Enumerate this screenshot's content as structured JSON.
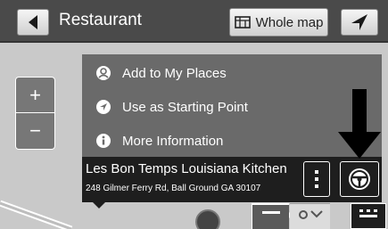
{
  "header": {
    "title": "Restaurant",
    "back_icon": "chevron-left-icon",
    "whole_map_label": "Whole map",
    "whole_map_icon": "map-icon",
    "navigation_icon": "navigation-arrow-icon"
  },
  "zoom": {
    "in_label": "+",
    "out_label": "−"
  },
  "menu": {
    "items": [
      {
        "label": "Add to My Places",
        "icon": "add-place-icon"
      },
      {
        "label": "Use as Starting Point",
        "icon": "starting-point-icon"
      },
      {
        "label": "More Information",
        "icon": "info-icon"
      }
    ]
  },
  "destination": {
    "name": "Les Bon Temps Louisiana Kitchen",
    "address": "248 Gilmer Ferry Rd, Ball Ground GA 30107",
    "more_icon": "more-vertical-icon",
    "drive_icon": "steering-wheel-icon"
  },
  "colors": {
    "header_bg": "#4a4a4a",
    "menu_bg": "#6a6a6a",
    "card_bg": "#1e1e1e",
    "map_bg": "#c9c9c9"
  }
}
